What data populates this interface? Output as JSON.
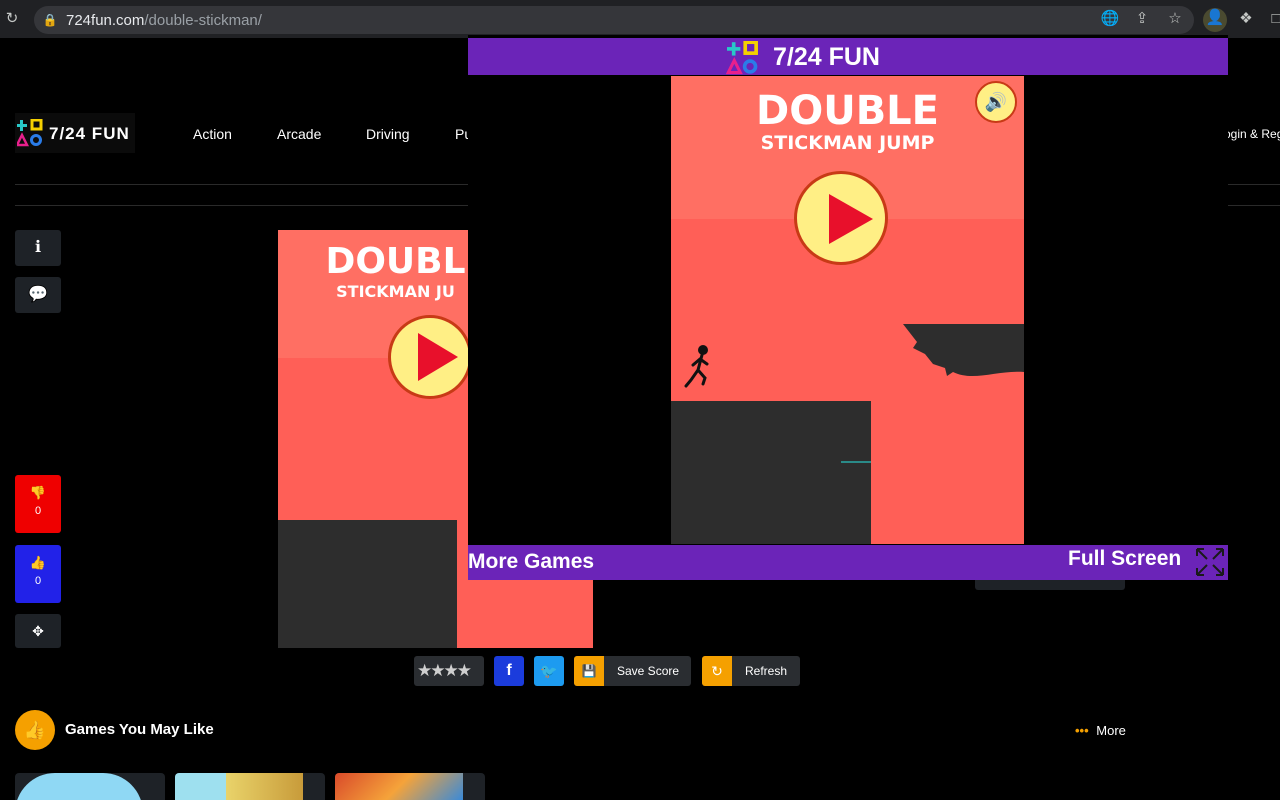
{
  "browser": {
    "url_host": "724fun.com",
    "url_path": "/double-stickman/"
  },
  "site": {
    "logo_text": "7/24 FUN",
    "nav": [
      "Action",
      "Arcade",
      "Driving",
      "Pu"
    ],
    "login": "ogin & Reg"
  },
  "side": {
    "dislike_count": "0",
    "like_count": "0"
  },
  "game": {
    "title_line1": "DOUBLE",
    "title_line2": "STICKMAN JUMP",
    "bg_title_line1": "DOUBL",
    "bg_title_line2": "STICKMAN JU"
  },
  "overlay": {
    "brand": "7/24 FUN",
    "more_games": "More Games",
    "full_screen": "Full Screen"
  },
  "actions": {
    "save_score": "Save Score",
    "refresh": "Refresh"
  },
  "games_section": {
    "title": "Games You May Like",
    "more": "More"
  },
  "colors": {
    "purple": "#6b24b8",
    "game_red": "#ff5f57",
    "orange": "#f5a000",
    "facebook": "#1b3cdc",
    "twitter": "#1d9bf0"
  }
}
